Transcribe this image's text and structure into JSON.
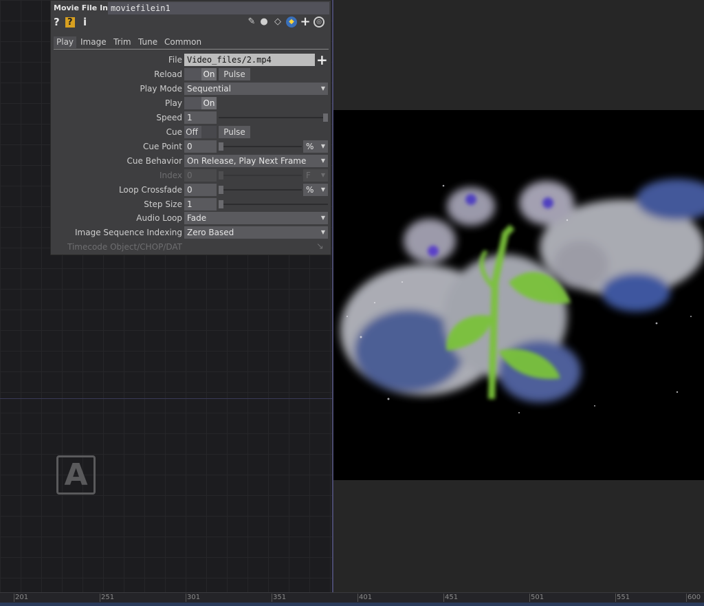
{
  "panel": {
    "type_label": "Movie File In",
    "node_name": "moviefilein1",
    "toolbar_left": [
      {
        "icon": "question-icon",
        "glyph": "?"
      },
      {
        "icon": "help-python-icon",
        "glyph": "?"
      },
      {
        "icon": "info-icon",
        "glyph": "i"
      }
    ],
    "toolbar_right": [
      "pencil-icon",
      "comment-icon",
      "clone-icon",
      "python-icon",
      "plus-icon",
      "target-icon"
    ],
    "tabs": [
      "Play",
      "Image",
      "Trim",
      "Tune",
      "Common"
    ],
    "active_tab": "Play",
    "params": {
      "file": {
        "label": "File",
        "value": "Video_files/2.mp4"
      },
      "reload": {
        "label": "Reload",
        "toggle": "On",
        "pulse": "Pulse"
      },
      "play_mode": {
        "label": "Play Mode",
        "value": "Sequential"
      },
      "play": {
        "label": "Play",
        "toggle": "On"
      },
      "speed": {
        "label": "Speed",
        "value": "1"
      },
      "cue": {
        "label": "Cue",
        "toggle": "Off",
        "pulse": "Pulse"
      },
      "cue_point": {
        "label": "Cue Point",
        "value": "0",
        "unit": "%"
      },
      "cue_behavior": {
        "label": "Cue Behavior",
        "value": "On Release, Play Next Frame"
      },
      "index": {
        "label": "Index",
        "value": "0",
        "unit": "F"
      },
      "loop_crossfade": {
        "label": "Loop Crossfade",
        "value": "0",
        "unit": "%"
      },
      "step_size": {
        "label": "Step Size",
        "value": "1"
      },
      "audio_loop": {
        "label": "Audio Loop",
        "value": "Fade"
      },
      "image_sequence_indexing": {
        "label": "Image Sequence Indexing",
        "value": "Zero Based"
      },
      "timecode_object": {
        "label": "Timecode Object/CHOP/DAT"
      }
    }
  },
  "network": {
    "logo_letter": "A"
  },
  "timeline": {
    "ticks": [
      "201",
      "251",
      "301",
      "351",
      "401",
      "451",
      "501",
      "551",
      "600"
    ]
  },
  "colors": {
    "accent": "#4a4a6e",
    "flower_green": "#7ac23a",
    "flower_blue": "#3b5bb8",
    "particle_white": "#e8e8ee"
  }
}
